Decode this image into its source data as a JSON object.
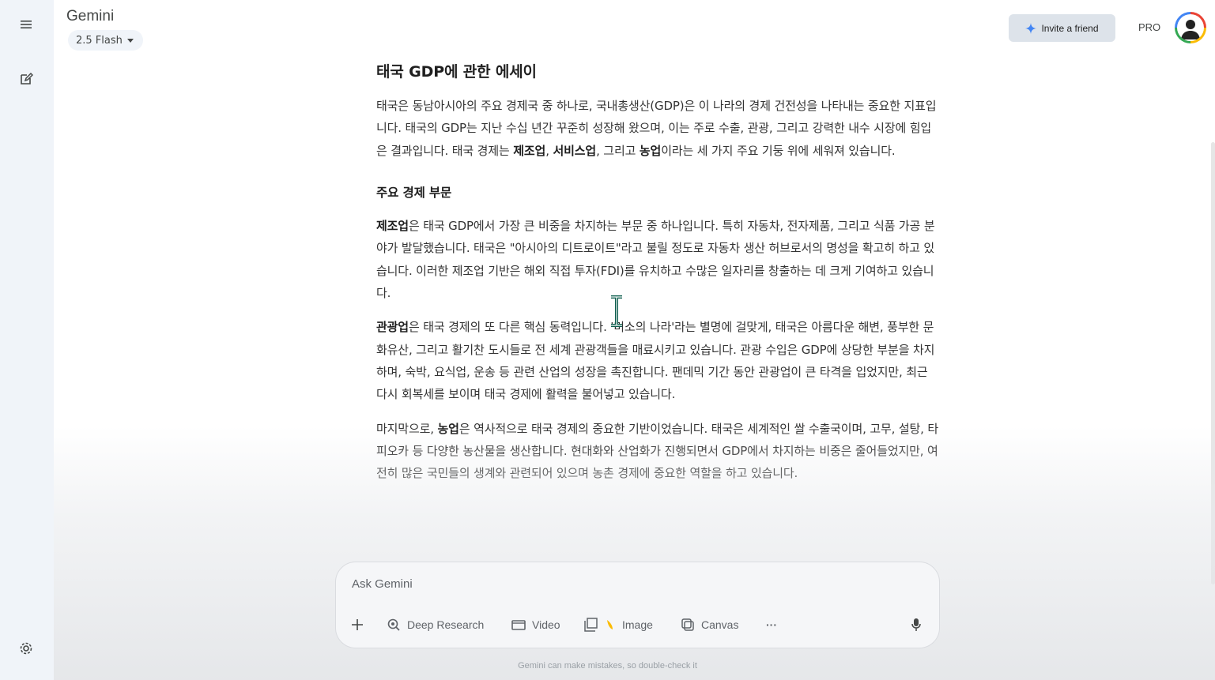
{
  "app": {
    "title": "Gemini",
    "model": "2.5 Flash",
    "invite_label": "Invite a friend",
    "pro_label": "PRO"
  },
  "rail": {
    "icons": [
      "menu-icon",
      "new-chat-icon",
      "settings-icon"
    ]
  },
  "article": {
    "title": "태국 GDP에 관한 에세이",
    "intro": [
      {
        "t": "태국은 동남아시아의 주요 경제국 중 하나로, 국내총생산(GDP)은 이 나라의 경제 건전성을 나타내는 중요한 지표입니다. 태국의 GDP는 지난 수십 년간 꾸준히 성장해 왔으며, 이는 주로 수출, 관광, 그리고 강력한 내수 시장에 힘입은 결과입니다. 태국 경제는 ",
        "b": false
      },
      {
        "t": "제조업",
        "b": true
      },
      {
        "t": ", ",
        "b": false
      },
      {
        "t": "서비스업",
        "b": true
      },
      {
        "t": ", 그리고 ",
        "b": false
      },
      {
        "t": "농업",
        "b": true
      },
      {
        "t": "이라는 세 가지 주요 기둥 위에 세워져 있습니다.",
        "b": false
      }
    ],
    "section_title": "주요 경제 부문",
    "p1": [
      {
        "t": "제조업",
        "b": true
      },
      {
        "t": "은 태국 GDP에서 가장 큰 비중을 차지하는 부문 중 하나입니다. 특히 자동차, 전자제품, 그리고 식품 가공 분야가 발달했습니다. 태국은 \"아시아의 디트로이트\"라고 불릴 정도로 자동차 생산 허브로서의 명성을 확고히 하고 있습니다. 이러한 제조업 기반은 해외 직접 투자(FDI)를 유치하고 수많은 일자리를 창출하는 데 크게 기여하고 있습니다.",
        "b": false
      }
    ],
    "p2": [
      {
        "t": "관광업",
        "b": true
      },
      {
        "t": "은 태국 경제의 또 다른 핵심 동력입니다. '미소의 나라'라는 별명에 걸맞게, 태국은 아름다운 해변, 풍부한 문화유산, 그리고 활기찬 도시들로 전 세계 관광객들을 매료시키고 있습니다.  관광 수입은 GDP에 상당한 부분을 차지하며, 숙박, 요식업, 운송 등 관련 산업의 성장을 촉진합니다. 팬데믹 기간 동안 관광업이 큰 타격을 입었지만, 최근 다시 회복세를 보이며 태국 경제에 활력을 불어넣고 있습니다.",
        "b": false
      }
    ],
    "p3": [
      {
        "t": "마지막으로, ",
        "b": false
      },
      {
        "t": "농업",
        "b": true
      },
      {
        "t": "은 역사적으로 태국 경제의 중요한 기반이었습니다. 태국은 세계적인 쌀 수출국이며, 고무, 설탕, 타피오카 등 다양한 농산물을 생산합니다. 현대화와 산업화가 진행되면서 GDP에서 차지하는 비중은 줄어들었지만, 여전히 많은 국민들의 생계와 관련되어 있으며 농촌 경제에 중요한 역할을 하고 있습니다.",
        "b": false
      }
    ]
  },
  "composer": {
    "placeholder": "Ask Gemini",
    "tools": {
      "deep_research": "Deep Research",
      "video": "Video",
      "image": "Image",
      "canvas": "Canvas",
      "more": "···"
    }
  },
  "disclaimer": "Gemini can make mistakes, so double-check it"
}
